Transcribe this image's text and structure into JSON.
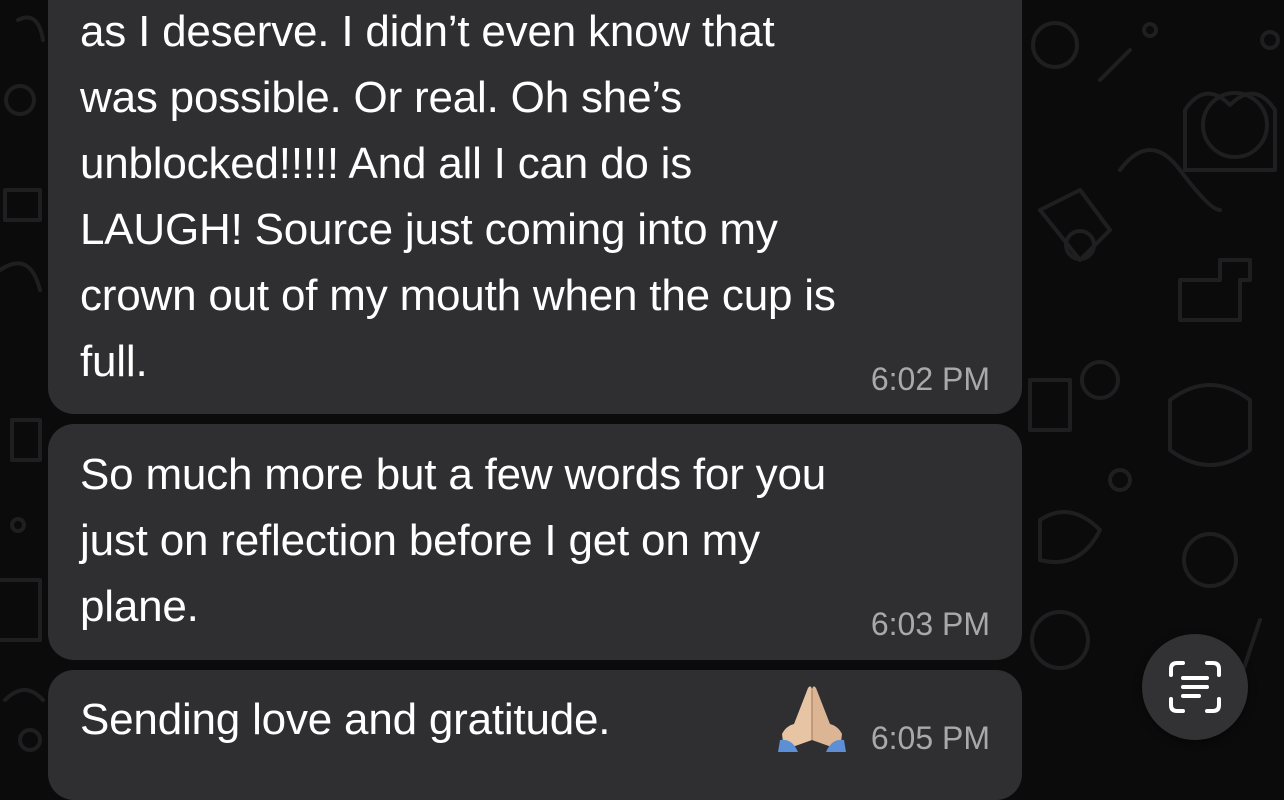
{
  "chat": {
    "messages": [
      {
        "text": "as I deserve. I didn’t even know that\nwas possible. Or real. Oh she’s\nunblocked!!!!! And all I can do is\nLAUGH! Source just coming into my\ncrown out of my mouth when the cup is\nfull.",
        "time": "6:02 PM"
      },
      {
        "text": "So much more but a few words for you\njust on reflection before I get on my\nplane.",
        "time": "6:03 PM"
      },
      {
        "text": "Sending love and gratitude.",
        "emoji": "folded-hands-emoji",
        "time": "6:05 PM"
      }
    ]
  },
  "overlay": {
    "live_text_icon": "live-text-scan-icon"
  },
  "colors": {
    "background": "#0b0b0c",
    "bubble": "#2f2f31",
    "text": "#ffffff",
    "timestamp": "#a8a8ad",
    "doodle": "#1e1e20"
  }
}
